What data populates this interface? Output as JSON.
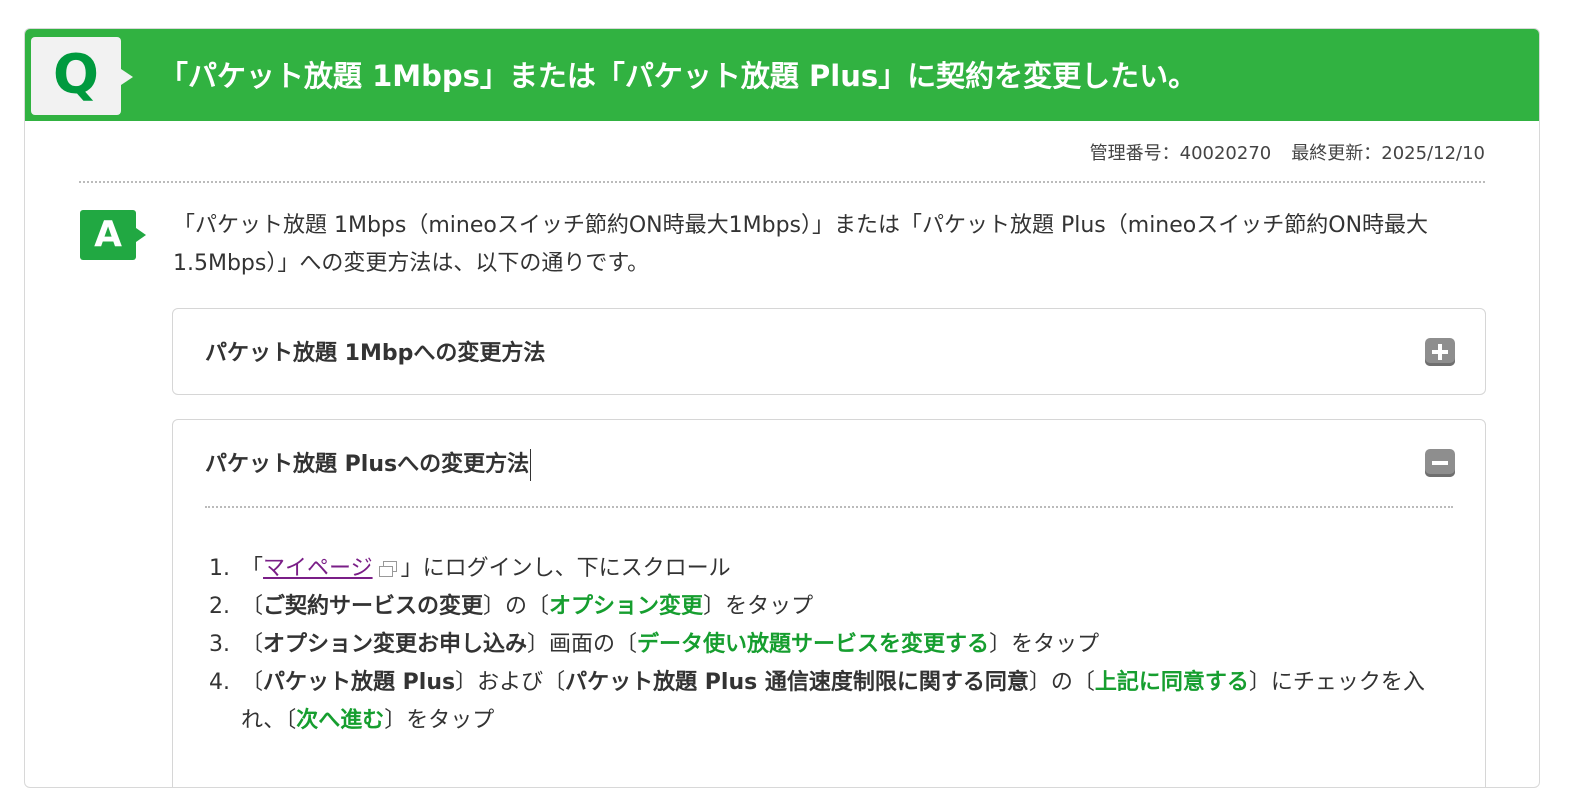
{
  "question": {
    "badge": "Q",
    "title": "「パケット放題 1Mbps」または「パケット放題 Plus」に契約を変更したい。"
  },
  "meta": {
    "id_label": "管理番号：40020270",
    "updated_label": "最終更新：2025/12/10"
  },
  "answer": {
    "badge": "A",
    "text": "「パケット放題 1Mbps（mineoスイッチ節約ON時最大1Mbps）」または「パケット放題 Plus（mineoスイッチ節約ON時最大1.5Mbps）」への変更方法は、以下の通りです。"
  },
  "accordions": [
    {
      "title": "パケット放題 1Mbpへの変更方法",
      "state": "collapsed",
      "icon": "plus-icon"
    },
    {
      "title": "パケット放題 Plusへの変更方法",
      "state": "expanded",
      "icon": "minus-icon"
    }
  ],
  "steps": {
    "s1": {
      "num": "1.",
      "pre": "「",
      "link": "マイページ",
      "post": "」にログインし、下にスクロール"
    },
    "s2": {
      "num": "2.",
      "p1": "〔",
      "b1": "ご契約サービスの変更",
      "p2": "〕の〔",
      "g1": "オプション変更",
      "p3": "〕をタップ"
    },
    "s3": {
      "num": "3.",
      "p1": "〔",
      "b1": "オプション変更お申し込み",
      "p2": "〕画面の〔",
      "g1": "データ使い放題サービスを変更する",
      "p3": "〕をタップ"
    },
    "s4": {
      "num": "4.",
      "p1": "〔",
      "b1": "パケット放題 Plus",
      "p2": "〕および〔",
      "b2": "パケット放題 Plus 通信速度制限に関する同意",
      "p3": "〕の〔",
      "g1": "上記に同意する",
      "p4": "〕にチェックを入れ、〔",
      "g2": "次へ進む",
      "p5": "〕をタップ"
    }
  },
  "colors": {
    "brand_green": "#31b241",
    "accent_green": "#169e2f",
    "link_purple": "#7a1e87"
  }
}
